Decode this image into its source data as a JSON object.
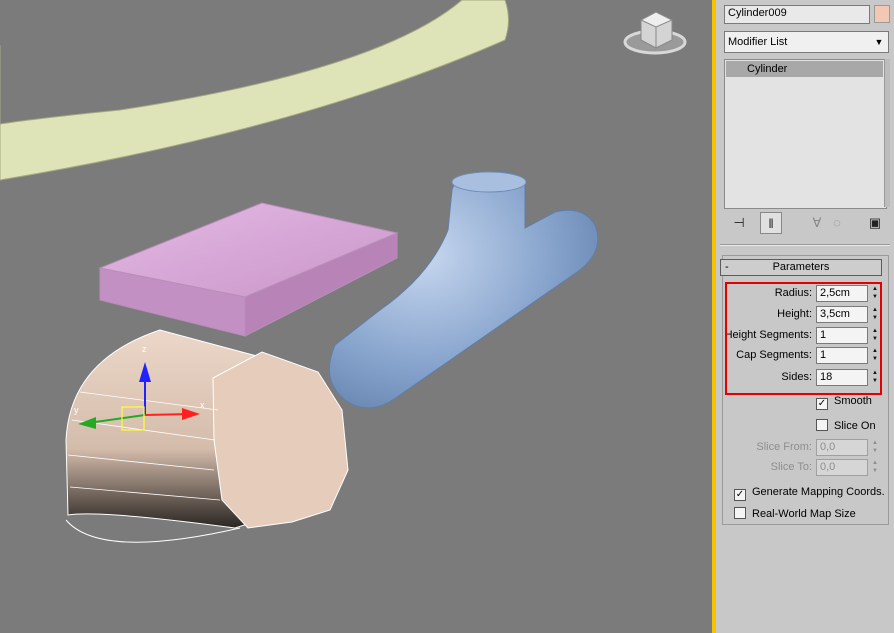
{
  "viewport": {
    "view_cube_icon": "viewcube-icon",
    "gizmo_labels": {
      "z": "z",
      "x": "x",
      "y": "y"
    },
    "colors": {
      "background": "#7b7b7b",
      "ring": "#dfe3b8",
      "box": "#cfa0cf",
      "capsule": "#86a3cc",
      "cylinder": "#e5ccbb"
    }
  },
  "panel": {
    "object_name": "Cylinder009",
    "object_color": "#f2c7b3",
    "modifier_list": "Modifier List",
    "modifier_stack": [
      "Cylinder"
    ],
    "stack_tools": [
      "pin-stack-icon",
      "show-end-result-icon",
      "make-unique-icon",
      "remove-modifier-icon",
      "configure-modifier-sets-icon"
    ],
    "rollout": {
      "collapse_symbol": "-",
      "title": "Parameters",
      "fields": [
        {
          "label": "Radius:",
          "value": "2,5cm"
        },
        {
          "label": "Height:",
          "value": "3,5cm"
        },
        {
          "label": "Height Segments:",
          "value": "1"
        },
        {
          "label": "Cap Segments:",
          "value": "1"
        },
        {
          "label": "Sides:",
          "value": "18"
        }
      ],
      "smooth": {
        "label": "Smooth",
        "checked": true
      },
      "slice_on": {
        "label": "Slice On",
        "checked": false
      },
      "slice_from": {
        "label": "Slice From:",
        "value": "0,0"
      },
      "slice_to": {
        "label": "Slice To:",
        "value": "0,0"
      },
      "generate_mapping": {
        "label": "Generate Mapping Coords.",
        "checked": true
      },
      "real_world_map": {
        "label": "Real-World Map Size",
        "checked": false
      }
    },
    "check_mark": "✓",
    "spinner_glyph": "▲▼",
    "accent_highlight": "#e20000"
  }
}
